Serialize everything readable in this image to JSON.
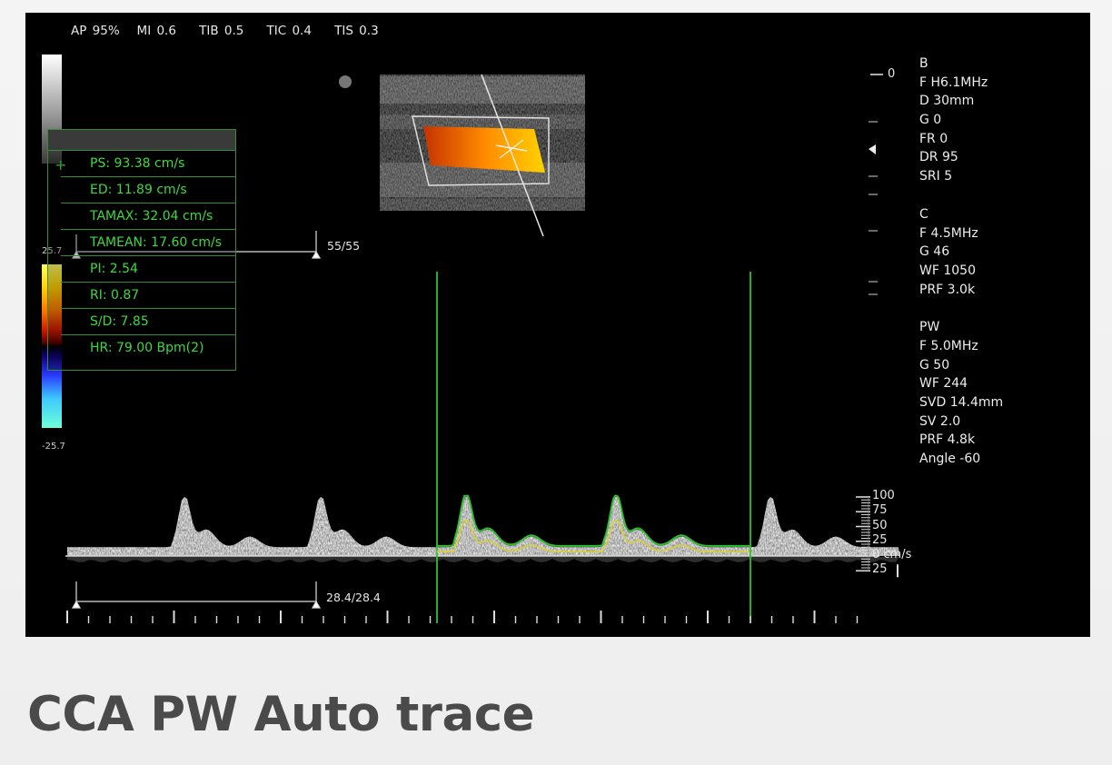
{
  "topbar": {
    "text": "AP 95%   MI 0.6    TIB 0.5    TIC 0.4    TIS 0.3"
  },
  "color_scale": {
    "top": "25.7",
    "bottom": "-25.7"
  },
  "measurements": [
    "PS: 93.38 cm/s",
    "ED: 11.89 cm/s",
    "TAMAX: 32.04 cm/s",
    "TAMEAN: 17.60 cm/s",
    "PI: 2.54",
    "RI: 0.87",
    "S/D: 7.85",
    "HR: 79.00 Bpm(2)"
  ],
  "measure_plus": "+",
  "caliper_top_label": "55/55",
  "caliper_bottom_label": "28.4/28.4",
  "params": {
    "b": [
      "B",
      "F H6.1MHz",
      "D 30mm",
      "G 0",
      "FR 0",
      "DR 95",
      "SRI 5"
    ],
    "c": [
      "C",
      "F 4.5MHz",
      "G 46",
      "WF 1050",
      "PRF 3.0k"
    ],
    "pw": [
      "PW",
      "F 5.0MHz",
      "G 50",
      "WF 244",
      "SVD 14.4mm",
      "SV 2.0",
      "PRF 4.8k",
      "Angle -60"
    ]
  },
  "depth_axis": {
    "top_label": "0"
  },
  "velocity_axis": {
    "labels": [
      {
        "value": 100,
        "text": "100"
      },
      {
        "value": 75,
        "text": "75"
      },
      {
        "value": 50,
        "text": "50"
      },
      {
        "value": 25,
        "text": "25"
      },
      {
        "value": 0,
        "text": "0 cm/s"
      },
      {
        "value": -25,
        "text": "25"
      }
    ]
  },
  "caption": "CCA PW Auto trace",
  "colors": {
    "trace_green": "#2fbf2f",
    "mean_yellow": "#d8d030",
    "text_green": "#3fd93f"
  }
}
